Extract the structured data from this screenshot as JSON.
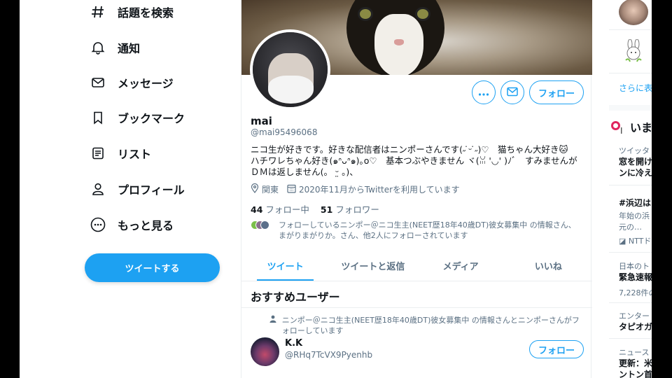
{
  "nav": {
    "items": [
      {
        "label": "話題を検索",
        "icon": "hashtag-icon"
      },
      {
        "label": "通知",
        "icon": "bell-icon"
      },
      {
        "label": "メッセージ",
        "icon": "envelope-icon"
      },
      {
        "label": "ブックマーク",
        "icon": "bookmark-icon"
      },
      {
        "label": "リスト",
        "icon": "list-icon"
      },
      {
        "label": "プロフィール",
        "icon": "person-icon"
      },
      {
        "label": "もっと見る",
        "icon": "more-circle-icon"
      }
    ],
    "tweet_button": "ツイートする"
  },
  "profile": {
    "name": "mai",
    "handle": "@mai95496068",
    "follow_button": "フォロー",
    "bio_lines": [
      "ニコ生が好きです。好きな配信者はニンポーさんです(˶ ̇ᵕ ̇˶)♡　猫ちゃん大好き🐱",
      "ハチワレちゃん好き(๑ᐢᴗᐢ๑)｡o♡　基本つぶやきません ヾ(ꈍ '◡' )ﾉﾞ　すみませんが",
      "ＤＭは返しません(。 ᵕ̤ 。)、"
    ],
    "location": "関東",
    "joined": "2020年11月からTwitterを利用しています",
    "following_count": "44",
    "following_label": "フォロー中",
    "followers_count": "51",
    "followers_label": "フォロワー",
    "known_followers_text": "フォローしているニンポー＠ニコ生主(NEET歴18年40歳DT)彼女募集中 の情報さん、まがりまがりか。さん、他2人にフォローされています"
  },
  "tabs": [
    "ツイート",
    "ツイートと返信",
    "メディア",
    "いいね"
  ],
  "suggestions": {
    "title": "おすすめユーザー",
    "context": "ニンポー＠ニコ生主(NEET歴18年40歳DT)彼女募集中 の情報さんとニンポーさんがフォローしています",
    "user_name": "K.K",
    "user_handle": "@RHq7TcVX9Pyenhb",
    "follow_button": "フォロー"
  },
  "right": {
    "show_more": "さらに表",
    "trends_title": "いまど",
    "t1_category": "ツイッタ",
    "t1_line1": "窓を開け",
    "t1_line2": "ンに冷え",
    "t2_title": "#浜辺は",
    "t2_line1": "年始の浜",
    "t2_line2": "元の…",
    "t2_source": "NTTド",
    "t3_category": "日本のト",
    "t3_title": "緊急速報",
    "t3_count": "7,228件の",
    "t4_category": "エンター",
    "t4_title": "タピオガ",
    "t5_category": "ニュース",
    "t5_line1": "更新：米",
    "t5_line2": "ントン首"
  },
  "colors": {
    "accent": "#1da1f2",
    "muted": "#5b7083",
    "text": "#0f1419"
  }
}
